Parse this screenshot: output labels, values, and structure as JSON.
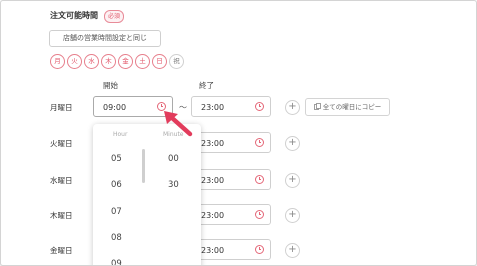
{
  "section": {
    "title": "注文可能時間",
    "required_badge": "必須"
  },
  "same_as_store_button": "店舗の営業時間設定と同じ",
  "days": [
    "月",
    "火",
    "水",
    "木",
    "金",
    "土",
    "日"
  ],
  "holiday_label": "祝",
  "columns": {
    "start": "開始",
    "end": "終了"
  },
  "rows": [
    {
      "label": "月曜日",
      "start": "09:00",
      "end": "23:00"
    },
    {
      "label": "火曜日",
      "end": "23:00"
    },
    {
      "label": "水曜日",
      "end": "23:00"
    },
    {
      "label": "木曜日",
      "end": "23:00"
    },
    {
      "label": "金曜日",
      "end": "23:00"
    }
  ],
  "tilde": "〜",
  "add_symbol": "+",
  "copy_button": "全ての曜日にコピー",
  "picker": {
    "hour_header": "Hour",
    "minute_header": "Minute",
    "hours": [
      "05",
      "06",
      "07",
      "08",
      "09"
    ],
    "minutes": [
      "00",
      "30"
    ]
  },
  "colors": {
    "accent": "#e25669",
    "arrow": "#e23c5c"
  },
  "icons": [
    "clock-icon",
    "copy-icon",
    "plus-icon",
    "pointer-arrow-icon"
  ]
}
